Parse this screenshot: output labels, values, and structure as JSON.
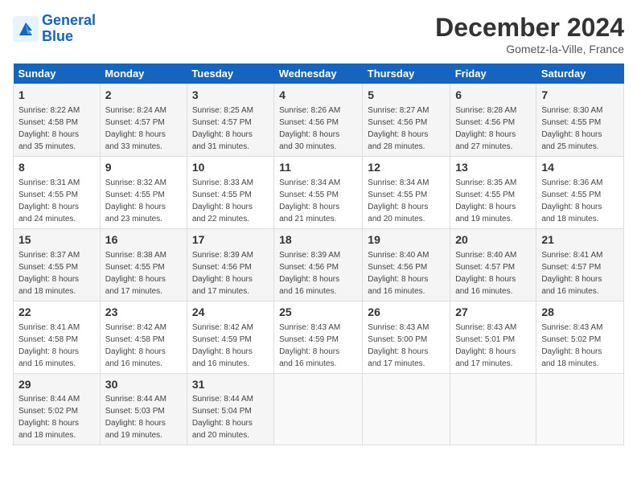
{
  "header": {
    "logo_line1": "General",
    "logo_line2": "Blue",
    "month": "December 2024",
    "location": "Gometz-la-Ville, France"
  },
  "days_of_week": [
    "Sunday",
    "Monday",
    "Tuesday",
    "Wednesday",
    "Thursday",
    "Friday",
    "Saturday"
  ],
  "weeks": [
    [
      {
        "day": "1",
        "info": "Sunrise: 8:22 AM\nSunset: 4:58 PM\nDaylight: 8 hours\nand 35 minutes."
      },
      {
        "day": "2",
        "info": "Sunrise: 8:24 AM\nSunset: 4:57 PM\nDaylight: 8 hours\nand 33 minutes."
      },
      {
        "day": "3",
        "info": "Sunrise: 8:25 AM\nSunset: 4:57 PM\nDaylight: 8 hours\nand 31 minutes."
      },
      {
        "day": "4",
        "info": "Sunrise: 8:26 AM\nSunset: 4:56 PM\nDaylight: 8 hours\nand 30 minutes."
      },
      {
        "day": "5",
        "info": "Sunrise: 8:27 AM\nSunset: 4:56 PM\nDaylight: 8 hours\nand 28 minutes."
      },
      {
        "day": "6",
        "info": "Sunrise: 8:28 AM\nSunset: 4:56 PM\nDaylight: 8 hours\nand 27 minutes."
      },
      {
        "day": "7",
        "info": "Sunrise: 8:30 AM\nSunset: 4:55 PM\nDaylight: 8 hours\nand 25 minutes."
      }
    ],
    [
      {
        "day": "8",
        "info": "Sunrise: 8:31 AM\nSunset: 4:55 PM\nDaylight: 8 hours\nand 24 minutes."
      },
      {
        "day": "9",
        "info": "Sunrise: 8:32 AM\nSunset: 4:55 PM\nDaylight: 8 hours\nand 23 minutes."
      },
      {
        "day": "10",
        "info": "Sunrise: 8:33 AM\nSunset: 4:55 PM\nDaylight: 8 hours\nand 22 minutes."
      },
      {
        "day": "11",
        "info": "Sunrise: 8:34 AM\nSunset: 4:55 PM\nDaylight: 8 hours\nand 21 minutes."
      },
      {
        "day": "12",
        "info": "Sunrise: 8:34 AM\nSunset: 4:55 PM\nDaylight: 8 hours\nand 20 minutes."
      },
      {
        "day": "13",
        "info": "Sunrise: 8:35 AM\nSunset: 4:55 PM\nDaylight: 8 hours\nand 19 minutes."
      },
      {
        "day": "14",
        "info": "Sunrise: 8:36 AM\nSunset: 4:55 PM\nDaylight: 8 hours\nand 18 minutes."
      }
    ],
    [
      {
        "day": "15",
        "info": "Sunrise: 8:37 AM\nSunset: 4:55 PM\nDaylight: 8 hours\nand 18 minutes."
      },
      {
        "day": "16",
        "info": "Sunrise: 8:38 AM\nSunset: 4:55 PM\nDaylight: 8 hours\nand 17 minutes."
      },
      {
        "day": "17",
        "info": "Sunrise: 8:39 AM\nSunset: 4:56 PM\nDaylight: 8 hours\nand 17 minutes."
      },
      {
        "day": "18",
        "info": "Sunrise: 8:39 AM\nSunset: 4:56 PM\nDaylight: 8 hours\nand 16 minutes."
      },
      {
        "day": "19",
        "info": "Sunrise: 8:40 AM\nSunset: 4:56 PM\nDaylight: 8 hours\nand 16 minutes."
      },
      {
        "day": "20",
        "info": "Sunrise: 8:40 AM\nSunset: 4:57 PM\nDaylight: 8 hours\nand 16 minutes."
      },
      {
        "day": "21",
        "info": "Sunrise: 8:41 AM\nSunset: 4:57 PM\nDaylight: 8 hours\nand 16 minutes."
      }
    ],
    [
      {
        "day": "22",
        "info": "Sunrise: 8:41 AM\nSunset: 4:58 PM\nDaylight: 8 hours\nand 16 minutes."
      },
      {
        "day": "23",
        "info": "Sunrise: 8:42 AM\nSunset: 4:58 PM\nDaylight: 8 hours\nand 16 minutes."
      },
      {
        "day": "24",
        "info": "Sunrise: 8:42 AM\nSunset: 4:59 PM\nDaylight: 8 hours\nand 16 minutes."
      },
      {
        "day": "25",
        "info": "Sunrise: 8:43 AM\nSunset: 4:59 PM\nDaylight: 8 hours\nand 16 minutes."
      },
      {
        "day": "26",
        "info": "Sunrise: 8:43 AM\nSunset: 5:00 PM\nDaylight: 8 hours\nand 17 minutes."
      },
      {
        "day": "27",
        "info": "Sunrise: 8:43 AM\nSunset: 5:01 PM\nDaylight: 8 hours\nand 17 minutes."
      },
      {
        "day": "28",
        "info": "Sunrise: 8:43 AM\nSunset: 5:02 PM\nDaylight: 8 hours\nand 18 minutes."
      }
    ],
    [
      {
        "day": "29",
        "info": "Sunrise: 8:44 AM\nSunset: 5:02 PM\nDaylight: 8 hours\nand 18 minutes."
      },
      {
        "day": "30",
        "info": "Sunrise: 8:44 AM\nSunset: 5:03 PM\nDaylight: 8 hours\nand 19 minutes."
      },
      {
        "day": "31",
        "info": "Sunrise: 8:44 AM\nSunset: 5:04 PM\nDaylight: 8 hours\nand 20 minutes."
      },
      null,
      null,
      null,
      null
    ]
  ]
}
